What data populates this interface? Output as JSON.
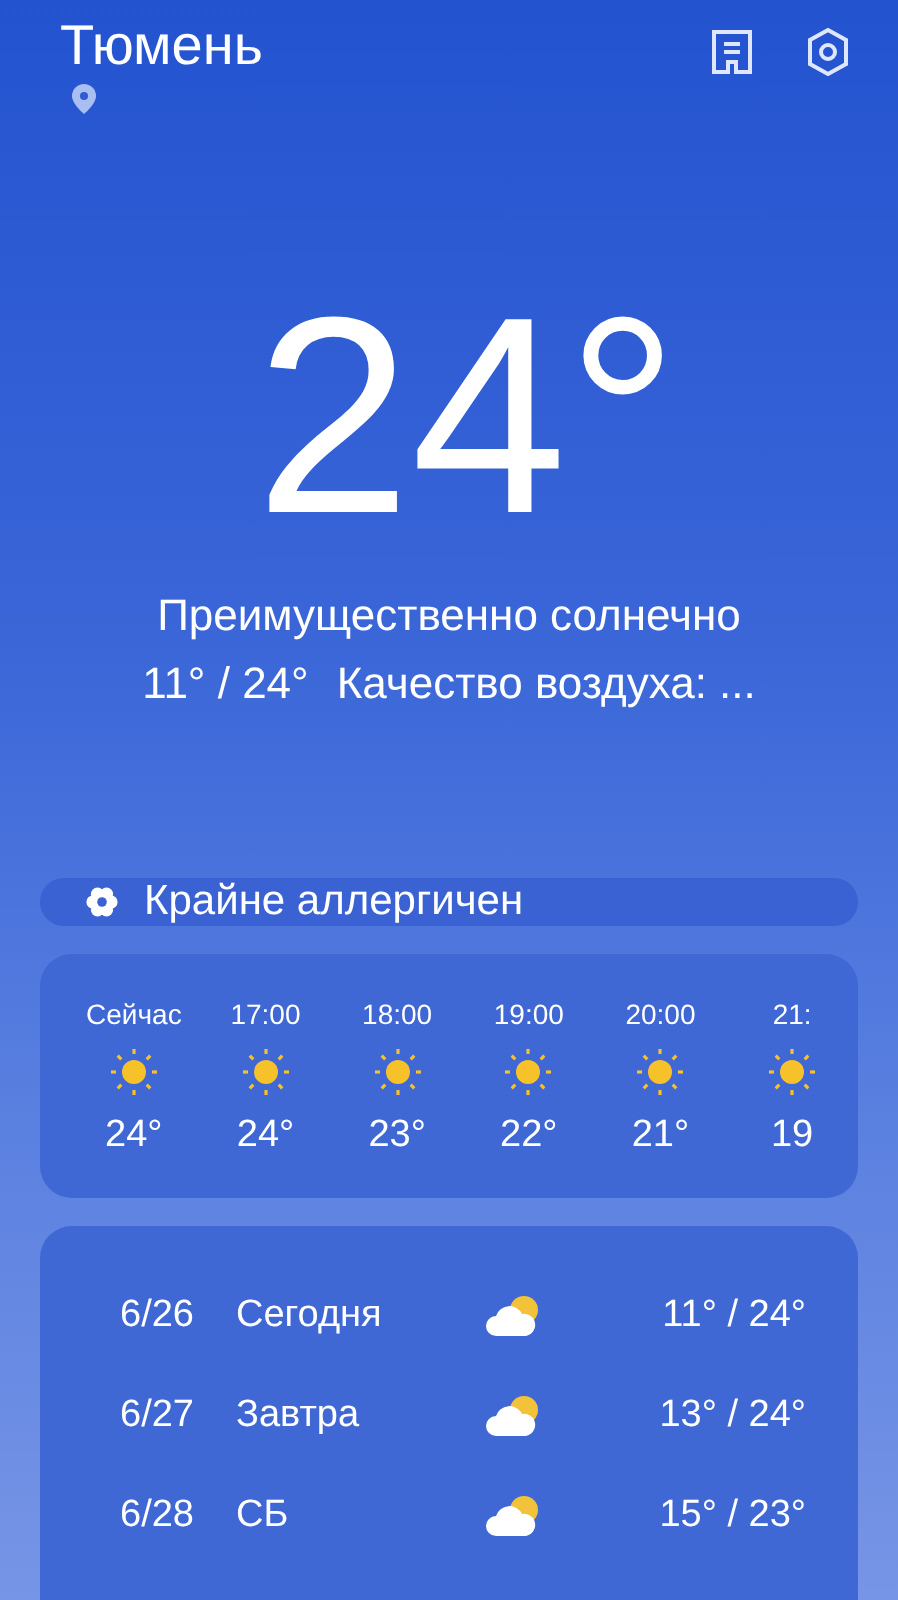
{
  "header": {
    "city": "Тюмень"
  },
  "current": {
    "temperature": "24°",
    "condition": "Преимущественно солнечно",
    "range": "11° / 24°",
    "air_quality": "Качество воздуха: ..."
  },
  "allergy": {
    "label": "Крайне аллергичен"
  },
  "hourly": [
    {
      "time": "Сейчас",
      "kind": "sunny",
      "temp": "24°"
    },
    {
      "time": "17:00",
      "kind": "sunny",
      "temp": "24°"
    },
    {
      "time": "18:00",
      "kind": "sunny",
      "temp": "23°"
    },
    {
      "time": "19:00",
      "kind": "sunny",
      "temp": "22°"
    },
    {
      "time": "20:00",
      "kind": "sunny",
      "temp": "21°"
    },
    {
      "time": "21:",
      "kind": "sunny",
      "temp": "19"
    }
  ],
  "daily": [
    {
      "date": "6/26",
      "day": "Сегодня",
      "kind": "partly-cloudy",
      "range": "11° / 24°"
    },
    {
      "date": "6/27",
      "day": "Завтра",
      "kind": "partly-cloudy",
      "range": "13° / 24°"
    },
    {
      "date": "6/28",
      "day": "СБ",
      "kind": "partly-cloudy",
      "range": "15° / 23°"
    }
  ]
}
